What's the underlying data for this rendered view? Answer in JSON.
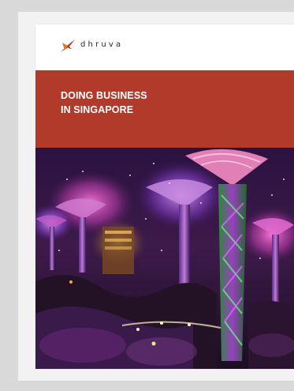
{
  "brand": {
    "logo_text": "dhruva",
    "accent_color": "#b23a2b",
    "logo_icon": "dhruva-star-logo-icon"
  },
  "cover": {
    "title_line1": "DOING BUSINESS",
    "title_line2": "IN SINGAPORE",
    "band_color": "#b23a2b",
    "photo": "gardens-by-the-bay-supertrees-night-image"
  }
}
